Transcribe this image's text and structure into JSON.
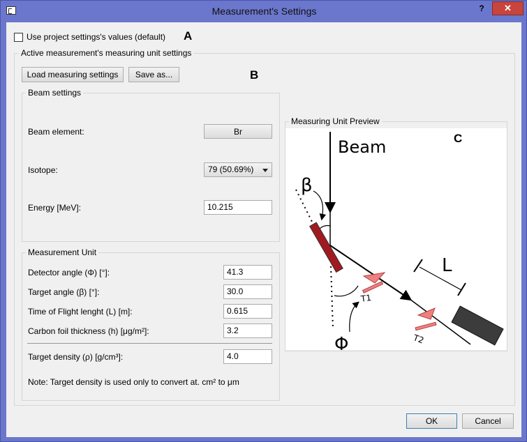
{
  "window": {
    "title": "Measurement's Settings",
    "help": "?",
    "close": "✕"
  },
  "use_project": {
    "label": "Use project settings's values (default)",
    "checked": false,
    "mark": "A"
  },
  "active_group": {
    "title": "Active measurement's measuring unit settings",
    "load_button": "Load measuring settings",
    "save_button": "Save as...",
    "mark": "B"
  },
  "beam": {
    "title": "Beam settings",
    "element_label": "Beam element:",
    "element_value": "Br",
    "isotope_label": "Isotope:",
    "isotope_value": "79 (50.69%)",
    "energy_label": "Energy [MeV]:",
    "energy_value": "10.215"
  },
  "measurement_unit": {
    "title": "Measurement Unit",
    "detector_angle_label": "Detector angle (Φ) [°]:",
    "detector_angle_value": "41.3",
    "target_angle_label": "Target angle (β) [°]:",
    "target_angle_value": "30.0",
    "tof_length_label": "Time of Flight lenght (L) [m]:",
    "tof_length_value": "0.615",
    "carbon_foil_label": "Carbon foil thickness (h) [μg/m²]:",
    "carbon_foil_value": "3.2",
    "target_density_label": "Target density (ρ) [g/cm³]:",
    "target_density_value": "4.0",
    "note": "Note: Target density is used only to convert at. cm² to μm"
  },
  "preview": {
    "title": "Measuring Unit Preview",
    "mark": "C",
    "beam_text": "Beam",
    "beta_text": "β",
    "phi_text": "Φ",
    "l_text": "L",
    "t1_text": "T1",
    "t2_text": "T2"
  },
  "buttons": {
    "ok": "OK",
    "cancel": "Cancel"
  },
  "colors": {
    "target": "#a11a1f",
    "timing_gate": "#f08080",
    "detector": "#3c3c3c",
    "title_bar": "#6b77cc",
    "close": "#c7453c"
  }
}
